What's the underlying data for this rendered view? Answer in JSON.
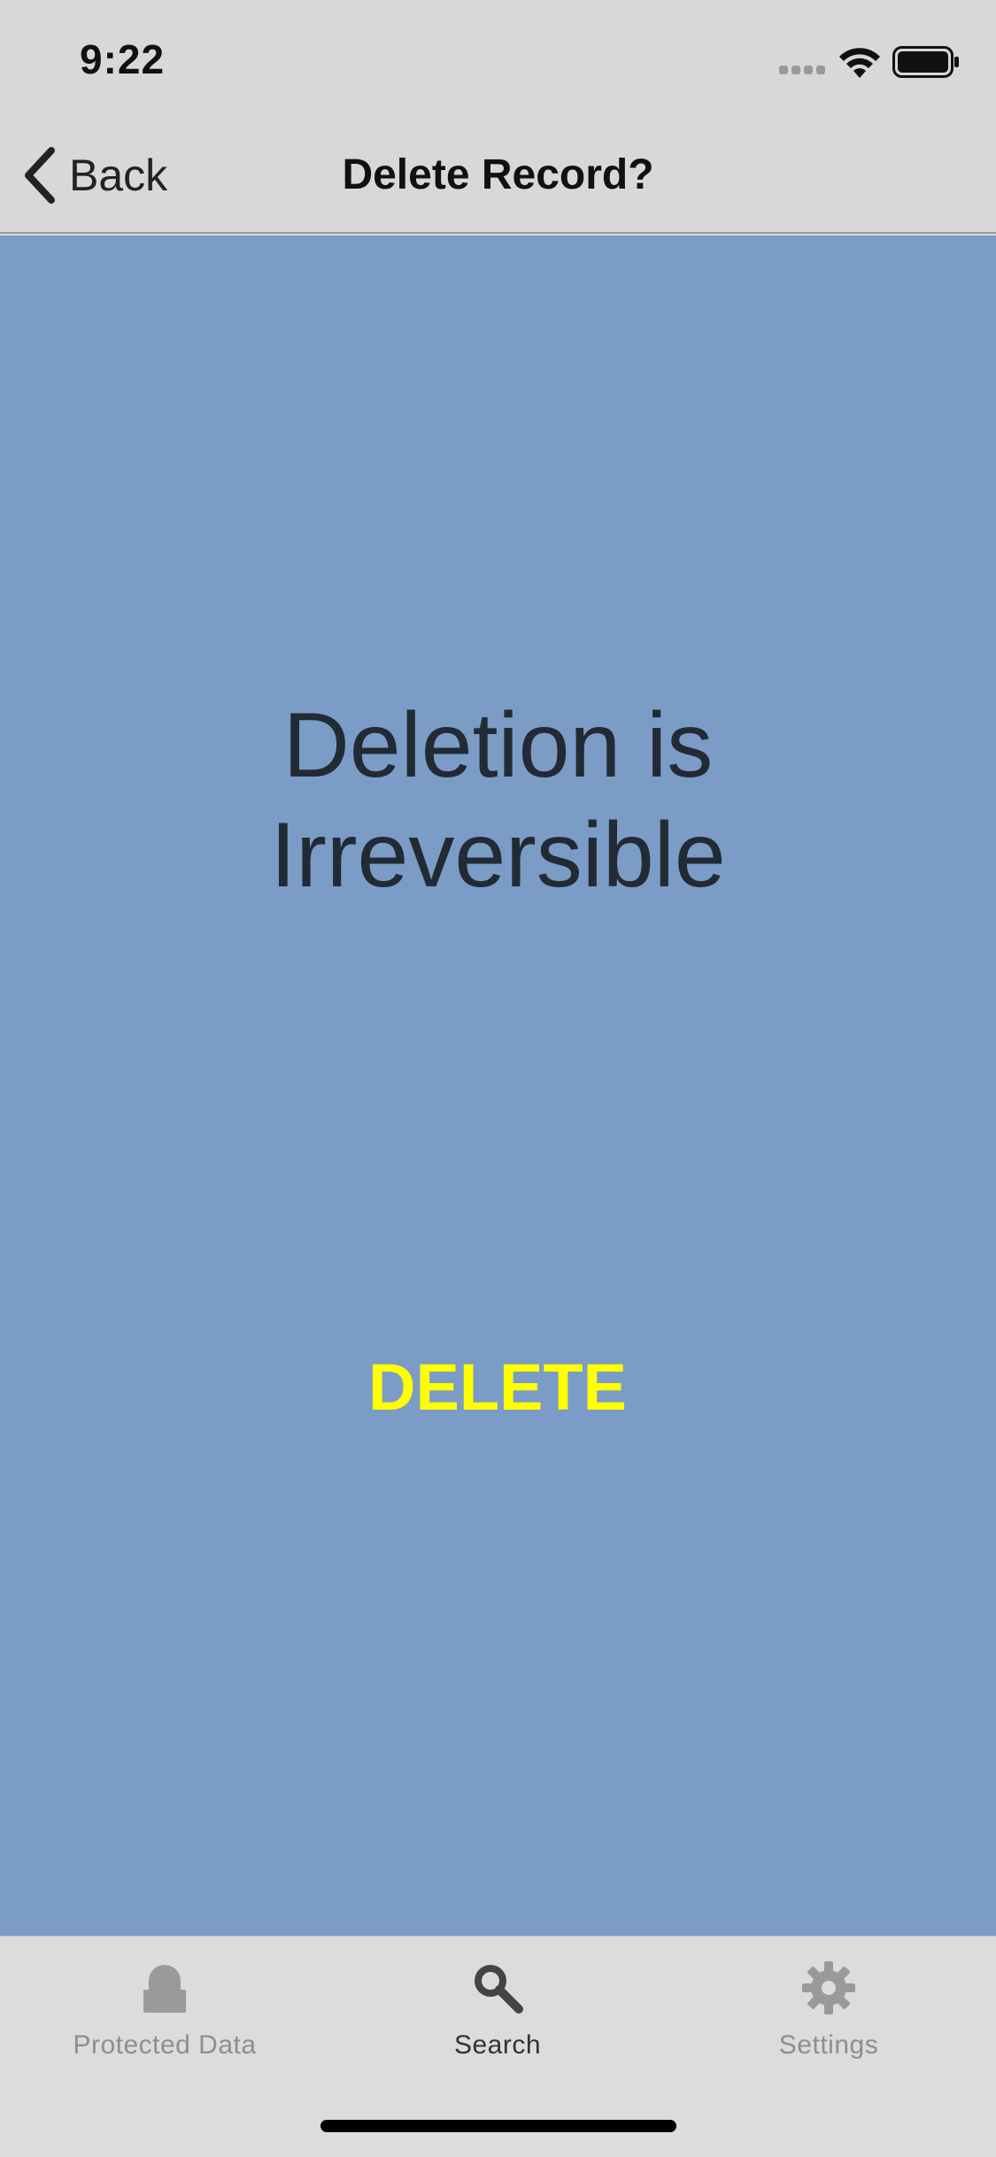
{
  "status_bar": {
    "time": "9:22"
  },
  "nav": {
    "back_label": "Back",
    "title": "Delete Record?"
  },
  "main": {
    "warning_line1": "Deletion is",
    "warning_line2": "Irreversible",
    "delete_label": "DELETE"
  },
  "tabs": [
    {
      "label": "Protected Data",
      "icon": "lock-icon",
      "active": false
    },
    {
      "label": "Search",
      "icon": "search-icon",
      "active": true
    },
    {
      "label": "Settings",
      "icon": "gear-icon",
      "active": false
    }
  ],
  "colors": {
    "content_background": "#7b9cc7",
    "delete_accent": "#ffff00",
    "bar_background": "#d8d8d8"
  }
}
